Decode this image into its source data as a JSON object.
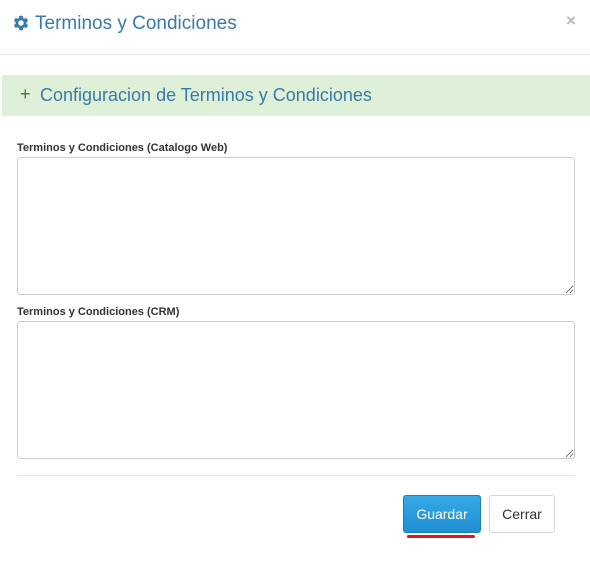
{
  "header": {
    "title": "Terminos y Condiciones",
    "icon": "gear-icon",
    "close_label": "×"
  },
  "panel": {
    "icon_label": "+",
    "title": "Configuracion de Terminos y Condiciones"
  },
  "fields": [
    {
      "label": "Terminos y Condiciones (Catalogo Web)",
      "value": ""
    },
    {
      "label": "Terminos y Condiciones (CRM)",
      "value": ""
    }
  ],
  "footer": {
    "save_label": "Guardar",
    "close_label": "Cerrar"
  },
  "colors": {
    "accent": "#3a7aa9",
    "panel_bg": "#dff0d8",
    "primary": "#2a9fe0",
    "underline": "#e0161d"
  }
}
